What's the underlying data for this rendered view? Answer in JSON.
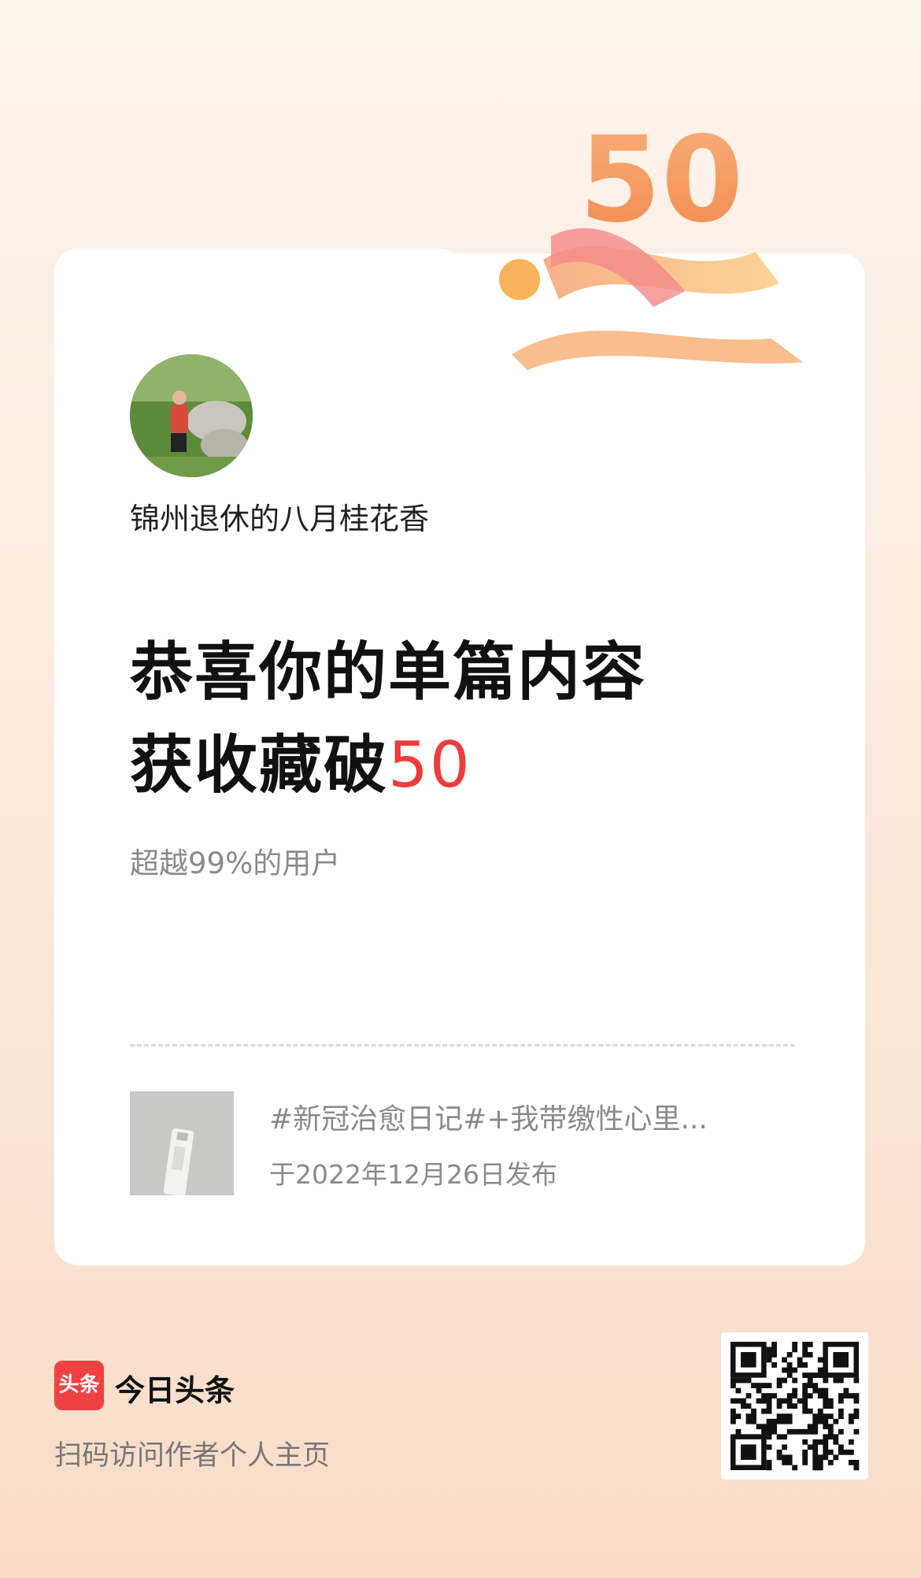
{
  "badge": {
    "number": "50"
  },
  "author": {
    "name": "锦州退休的八月桂花香"
  },
  "headline": {
    "line1": "恭喜你的单篇内容",
    "line2_prefix": "获收藏破",
    "line2_number": "50"
  },
  "subtext": "超越99%的用户",
  "post": {
    "title": "#新冠治愈日记#+我带缴性心里...",
    "date": "于2022年12月26日发布"
  },
  "brand": {
    "logo_text": "头条",
    "name": "今日头条",
    "scan_text": "扫码访问作者个人主页"
  },
  "colors": {
    "accent": "#ee3b3b",
    "brand_red": "#f04142",
    "badge_orange": "#f7a060"
  }
}
